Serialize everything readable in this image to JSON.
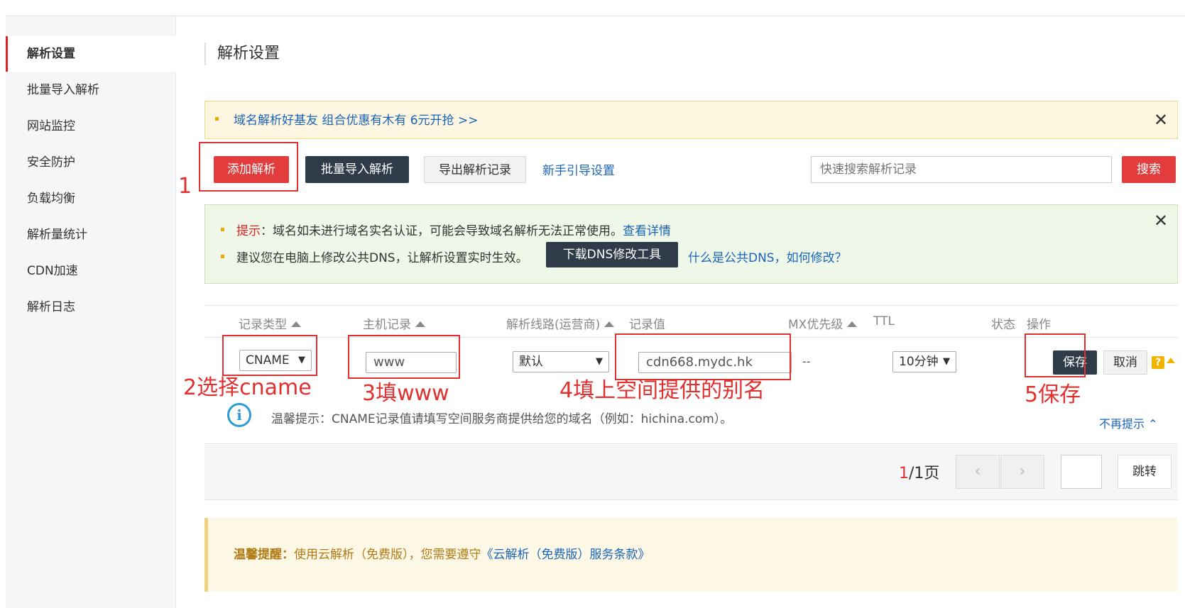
{
  "sidebar": {
    "items": [
      {
        "label": "解析设置"
      },
      {
        "label": "批量导入解析"
      },
      {
        "label": "网站监控"
      },
      {
        "label": "安全防护"
      },
      {
        "label": "负载均衡"
      },
      {
        "label": "解析量统计"
      },
      {
        "label": "CDN加速"
      },
      {
        "label": "解析日志"
      }
    ]
  },
  "page": {
    "title": "解析设置"
  },
  "promo": {
    "text": "域名解析好基友 组合优惠有木有 6元开抢 >>",
    "close": "✕"
  },
  "toolbar": {
    "add_label": "添加解析",
    "batch_import_label": "批量导入解析",
    "export_label": "导出解析记录",
    "guide_link": "新手引导设置",
    "search_placeholder": "快速搜索解析记录",
    "search_label": "搜索"
  },
  "tips": {
    "close": "✕",
    "warn_prefix": "提示",
    "line1_text": "：域名如未进行域名实名认证，可能会导致域名解析无法正常使用。",
    "line1_link": "查看详情",
    "line2_text": "建议您在电脑上修改公共DNS，让解析设置实时生效。",
    "download_label": "下载DNS修改工具",
    "line2_link": "什么是公共DNS，如何修改？"
  },
  "table": {
    "headers": {
      "type": "记录类型",
      "host": "主机记录",
      "line": "解析线路(运营商)",
      "value": "记录值",
      "mx": "MX优先级",
      "ttl": "TTL",
      "status": "状态",
      "action": "操作"
    },
    "edit_row": {
      "type": "CNAME",
      "host": "www",
      "line": "默认",
      "value": "cdn668.mydc.hk",
      "mx": "--",
      "ttl": "10分钟",
      "save": "保存",
      "cancel": "取消",
      "help": "?"
    }
  },
  "info": {
    "text": "温馨提示：CNAME记录值请填写空间服务商提供给您的域名（例如：hichina.com）。",
    "dismiss": "不再提示"
  },
  "pager": {
    "current": "1",
    "total_label": "/1页",
    "jump_label": "跳转",
    "prev": "‹",
    "next": "›"
  },
  "notice": {
    "label": "温馨提醒：",
    "text": "使用云解析（免费版），您需要遵守",
    "link": "《云解析（免费版）服务条款》"
  },
  "annotations": {
    "step1": "1",
    "step2": "2选择cname",
    "step3": "3填www",
    "step4": "4填上空间提供的别名",
    "step5": "5保存"
  },
  "colors": {
    "accent_red": "#e23c3c",
    "dark_button": "#2f3b48",
    "link_blue": "#1a64b8",
    "annotation_red": "#e03030"
  }
}
